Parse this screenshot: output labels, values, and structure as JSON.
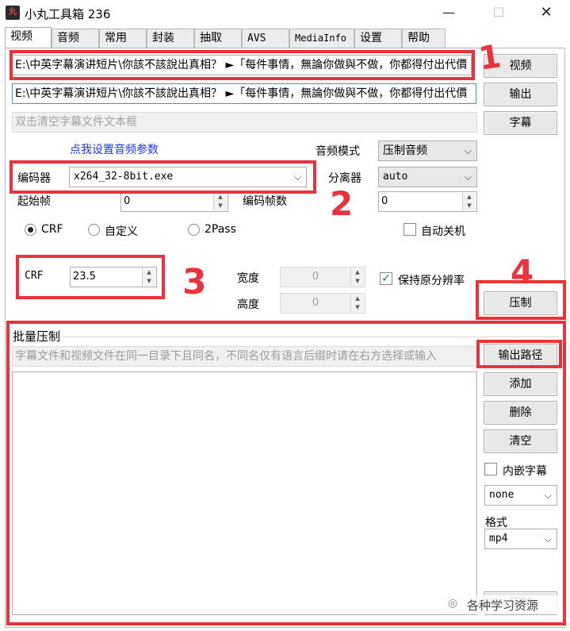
{
  "window": {
    "title": "小丸工具箱 236",
    "icon_text": "丸",
    "minimize_icon": "minimize-icon",
    "maximize_icon": "maximize-icon",
    "close_icon": "close-icon"
  },
  "tabs": [
    "视频",
    "音频",
    "常用",
    "封装",
    "抽取",
    "AVS",
    "MediaInfo",
    "设置",
    "帮助"
  ],
  "active_tab": "视频",
  "inputs": {
    "video_path": "E:\\中英字幕演讲短片\\你該不該說出真相？ ►「每件事情，無論你做與不做，你都得付出代價",
    "output_path": "E:\\中英字幕演讲短片\\你該不該說出真相？ ►「每件事情，無論你做與不做，你都得付出代價",
    "subtitle_placeholder": "双击清空字幕文件文本框"
  },
  "buttons": {
    "video": "视频",
    "output": "输出",
    "subtitle": "字幕",
    "compress": "压制",
    "output_path": "输出路径",
    "add": "添加",
    "delete": "删除",
    "clear": "清空",
    "batch_compress": "压制"
  },
  "audio": {
    "settings_link": "点我设置音频参数",
    "mode_label": "音频模式",
    "mode_value": "压制音频",
    "demuxer_label": "分离器",
    "demuxer_value": "auto"
  },
  "encoder": {
    "label": "编码器",
    "value": "x264_32-8bit.exe",
    "start_frame_label": "起始帧",
    "start_frame_value": "0",
    "frame_count_label": "编码帧数",
    "frame_count_value": "0"
  },
  "rate_modes": {
    "crf": "CRF",
    "custom": "自定义",
    "twopass": "2Pass",
    "selected": "CRF"
  },
  "auto_shutdown": {
    "label": "自动关机",
    "checked": false
  },
  "crf": {
    "label": "CRF",
    "value": "23.5"
  },
  "resolution": {
    "width_label": "宽度",
    "width_value": "0",
    "height_label": "高度",
    "height_value": "0",
    "keep_original_label": "保持原分辨率",
    "keep_original_checked": true
  },
  "batch": {
    "group_title": "批量压制",
    "hint": "字幕文件和视频文件在同一目录下且同名，不同名仅有语言后缀时请在右方选择或输入",
    "embed_subtitle_label": "内嵌字幕",
    "embed_subtitle_checked": false,
    "lang_suffix_value": "none",
    "format_label": "格式",
    "format_value": "mp4"
  },
  "annotations": {
    "n1": "1",
    "n2": "2",
    "n3": "3",
    "n4": "4",
    "color": "#e8323c"
  },
  "watermark": {
    "text": "各种学习资源"
  }
}
